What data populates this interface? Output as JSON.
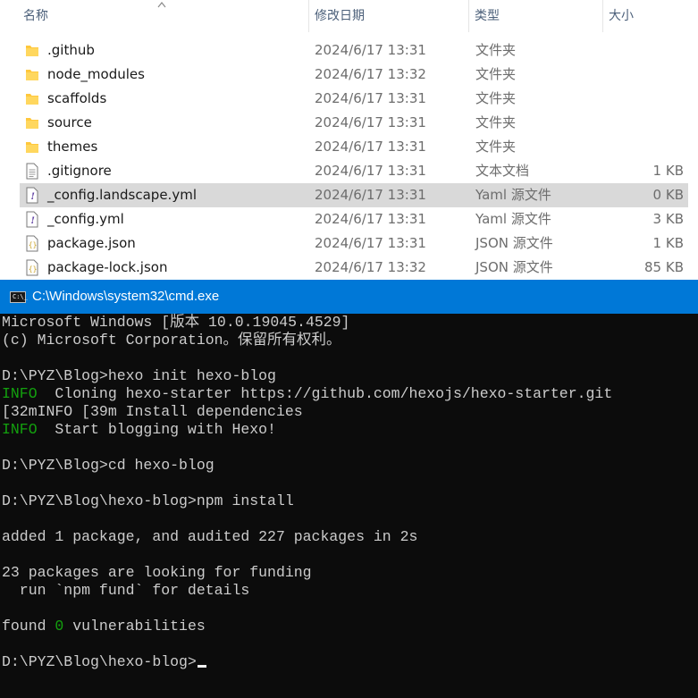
{
  "explorer": {
    "columns": {
      "name": "名称",
      "date": "修改日期",
      "type": "类型",
      "size": "大小"
    },
    "files": [
      {
        "name": ".github",
        "date": "2024/6/17 13:31",
        "type": "文件夹",
        "size": "",
        "icon": "folder-icon"
      },
      {
        "name": "node_modules",
        "date": "2024/6/17 13:32",
        "type": "文件夹",
        "size": "",
        "icon": "folder-icon"
      },
      {
        "name": "scaffolds",
        "date": "2024/6/17 13:31",
        "type": "文件夹",
        "size": "",
        "icon": "folder-icon"
      },
      {
        "name": "source",
        "date": "2024/6/17 13:31",
        "type": "文件夹",
        "size": "",
        "icon": "folder-icon"
      },
      {
        "name": "themes",
        "date": "2024/6/17 13:31",
        "type": "文件夹",
        "size": "",
        "icon": "folder-icon"
      },
      {
        "name": ".gitignore",
        "date": "2024/6/17 13:31",
        "type": "文本文档",
        "size": "1 KB",
        "icon": "text-file-icon"
      },
      {
        "name": "_config.landscape.yml",
        "date": "2024/6/17 13:31",
        "type": "Yaml 源文件",
        "size": "0 KB",
        "icon": "yaml-file-icon",
        "selected": true
      },
      {
        "name": "_config.yml",
        "date": "2024/6/17 13:31",
        "type": "Yaml 源文件",
        "size": "3 KB",
        "icon": "yaml-file-icon"
      },
      {
        "name": "package.json",
        "date": "2024/6/17 13:31",
        "type": "JSON 源文件",
        "size": "1 KB",
        "icon": "json-file-icon"
      },
      {
        "name": "package-lock.json",
        "date": "2024/6/17 13:32",
        "type": "JSON 源文件",
        "size": "85 KB",
        "icon": "json-file-icon"
      }
    ]
  },
  "cmd": {
    "title": "C:\\Windows\\system32\\cmd.exe",
    "icon_text": "C:\\_",
    "lines": {
      "l1": "Microsoft Windows [版本 10.0.19045.4529]",
      "l2": "(c) Microsoft Corporation。保留所有权利。",
      "l4": "D:\\PYZ\\Blog>hexo init hexo-blog",
      "l5_tag": "INFO",
      "l5_text": "  Cloning hexo-starter https://github.com/hexojs/hexo-starter.git",
      "l6": "[32mINFO [39m Install dependencies",
      "l7_tag": "INFO",
      "l7_text": "  Start blogging with Hexo!",
      "l9": "D:\\PYZ\\Blog>cd hexo-blog",
      "l11": "D:\\PYZ\\Blog\\hexo-blog>npm install",
      "l13": "added 1 package, and audited 227 packages in 2s",
      "l15": "23 packages are looking for funding",
      "l16": "  run `npm fund` for details",
      "l18_a": "found ",
      "l18_num": "0",
      "l18_b": " vulnerabilities",
      "l20": "D:\\PYZ\\Blog\\hexo-blog>"
    }
  },
  "colors": {
    "titlebar": "#0078d7",
    "console_bg": "#0c0c0c",
    "console_fg": "#cccccc",
    "console_green": "#13a10e",
    "selection": "#d9d9d9",
    "folder": "#ffc83d"
  }
}
